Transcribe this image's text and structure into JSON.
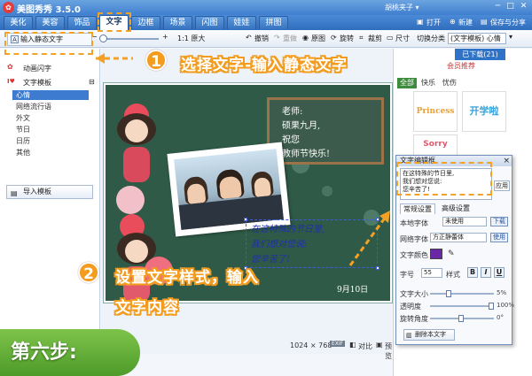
{
  "window": {
    "title": "美图秀秀 3.5.0",
    "user": "胡桃夹子 ▾",
    "minimize": "─",
    "maximize": "□",
    "close": "✕"
  },
  "tabs": [
    "美化",
    "美容",
    "饰品",
    "文字",
    "边框",
    "场景",
    "闪图",
    "娃娃",
    "拼图"
  ],
  "menu_right": {
    "open": "打开",
    "new": "新建",
    "save": "保存与分享"
  },
  "toolbar": {
    "zoom_out": "−",
    "zoom_in": "+",
    "original_size": "1:1 原大",
    "undo": "撤销",
    "redo": "重做",
    "original_image": "原图",
    "rotate": "旋转",
    "crop": "裁剪",
    "size": "尺寸",
    "category_label": "切换分类",
    "category_value": "(文字模板) 心情"
  },
  "left_panel": {
    "input_static": "输入静态文字",
    "animated": "动画闪字",
    "templates": "文字模板",
    "tree": [
      "心情",
      "网络流行语",
      "外文",
      "节日",
      "日历",
      "其他"
    ],
    "import": "导入模板"
  },
  "right_panel": {
    "header_btn": "已下载(21)",
    "sub_tabs": [
      "全部",
      "快乐",
      "忧伤"
    ],
    "more_link": "会员推荐",
    "thumb1": "Princess",
    "thumb2": "开学啦",
    "thumb3": "Sorry"
  },
  "canvas": {
    "blackboard_lines": [
      "老师:",
      "硕果九月,",
      "祝您",
      "教师节快乐!"
    ],
    "selected_text_lines": [
      "在这特殊的节日里,",
      "我们想对您说:",
      "您辛苦了!"
    ],
    "date_text": "9月10日"
  },
  "editor": {
    "title": "文字编辑框",
    "close": "×",
    "text_lines": [
      "在这特殊的节日里,",
      "我们想对您说:",
      "您辛苦了!"
    ],
    "apply": "应用",
    "tab_normal": "常规设置",
    "tab_advanced": "高级设置",
    "local_font_label": "本地字体",
    "local_font_value": "未使用",
    "download_btn": "下载",
    "web_font_label": "网络字体",
    "web_font_value": "方正静蕾体",
    "use_btn": "使用",
    "color_label": "文字颜色",
    "size_label": "字号",
    "size_value": "55",
    "style_label": "样式",
    "bold": "B",
    "italic": "I",
    "underline": "U",
    "opacity_label": "文字大小",
    "opacity_value": "5%",
    "transparency_label": "透明度",
    "transparency_value": "100%",
    "rotation_label": "旋转角度",
    "rotation_value": "0°",
    "delete": "删除本文字",
    "text_color": "#6a27a6"
  },
  "status": {
    "dimensions": "1024 × 768",
    "compare": "对比",
    "preview": "预览"
  },
  "annotations": {
    "step1_num": "1",
    "step1_text": "选择文字-输入静态文字",
    "step2_num": "2",
    "step2_line1": "设置文字样式，输入",
    "step2_line2": "文字内容",
    "step_badge": "第六步:"
  },
  "colors": {
    "accent_orange": "#f39c1e",
    "title_blue": "#3f7fcf",
    "step_green": "#5aa832"
  }
}
